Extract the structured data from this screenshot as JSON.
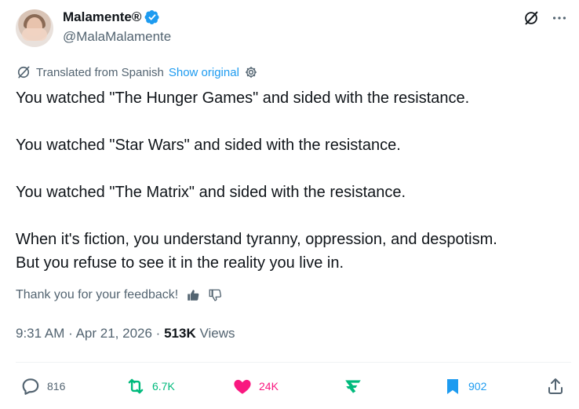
{
  "user": {
    "display_name": "Malamente®",
    "handle": "@MalaMalamente"
  },
  "translation": {
    "label": "Translated from Spanish",
    "show_original": "Show original"
  },
  "tweet": {
    "lines": [
      "You watched \"The Hunger Games\" and sided with the resistance.",
      "You watched \"Star Wars\" and sided with the resistance.",
      "You watched \"The Matrix\" and sided with the resistance.",
      "When it's fiction, you understand tyranny, oppression, and despotism.",
      "But you refuse to see it in the reality you live in."
    ]
  },
  "feedback": {
    "text": "Thank you for your feedback!"
  },
  "meta": {
    "time": "9:31 AM",
    "separator": "·",
    "date": "Apr 21, 2026",
    "views_count": "513K",
    "views_label": "Views"
  },
  "actions": {
    "replies": "816",
    "reposts": "6.7K",
    "likes": "24K",
    "bookmarks": "902"
  },
  "colors": {
    "verified": "#1d9bf0",
    "repost": "#00ba7c",
    "like": "#f91880",
    "bookmark": "#1d9bf0",
    "secondary_text": "#536471"
  },
  "icons": [
    "verified-badge-icon",
    "grok-icon",
    "more-icon",
    "translate-icon",
    "settings-icon",
    "thumbs-up-icon",
    "thumbs-down-icon",
    "reply-icon",
    "repost-icon",
    "like-icon",
    "analytics-icon",
    "bookmark-icon",
    "share-icon"
  ]
}
